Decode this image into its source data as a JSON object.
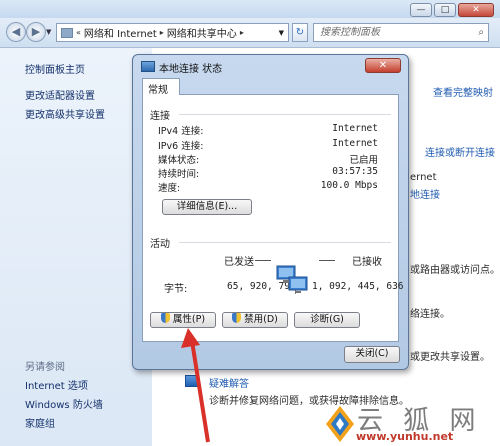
{
  "window": {
    "controls": {
      "minimize": "—",
      "maximize": "□",
      "close": "✕"
    }
  },
  "toolbar": {
    "address_prefix": "«",
    "breadcrumb": [
      "网络和 Internet",
      "网络和共享中心"
    ],
    "search_placeholder": "搜索控制面板"
  },
  "sidebar": {
    "items": [
      "控制面板主页",
      "更改适配器设置",
      "更改高级共享设置"
    ],
    "see_also_title": "另请参阅",
    "see_also": [
      "Internet 选项",
      "Windows 防火墙",
      "家庭组"
    ]
  },
  "main": {
    "view_full_map": "查看完整映射",
    "connect_disconnect": "连接或断开连接",
    "partial_internet": "ernet",
    "partial_connection": "地连接",
    "partial_router": "或路由器或访问点。",
    "partial_connect": "络连接。",
    "partial_share": "或更改共享设置。",
    "troubleshoot_title": "疑难解答",
    "troubleshoot_desc": "诊断并修复网络问题，或获得故障排除信息。"
  },
  "dialog": {
    "title": "本地连接 状态",
    "close": "✕",
    "tab": "常规",
    "connection_group": "连接",
    "rows": [
      {
        "label": "IPv4 连接:",
        "value": "Internet"
      },
      {
        "label": "IPv6 连接:",
        "value": "Internet"
      },
      {
        "label": "媒体状态:",
        "value": "已启用"
      },
      {
        "label": "持续时间:",
        "value": "03:57:35"
      },
      {
        "label": "速度:",
        "value": "100.0 Mbps"
      }
    ],
    "details_button": "详细信息(E)...",
    "activity_group": "活动",
    "sent_label": "已发送",
    "received_label": "已接收",
    "bytes_label": "字节:",
    "bytes_sent": "65, 920, 794",
    "bytes_received": "1, 092, 445, 636",
    "properties_button": "属性(P)",
    "disable_button": "禁用(D)",
    "diagnose_button": "诊断(G)",
    "close_button": "关闭(C)"
  },
  "watermark": {
    "text": "云 狐 网",
    "url": "www.yunhu.net"
  },
  "colors": {
    "arrow": "#d9302a",
    "link": "#1f5bb0"
  }
}
